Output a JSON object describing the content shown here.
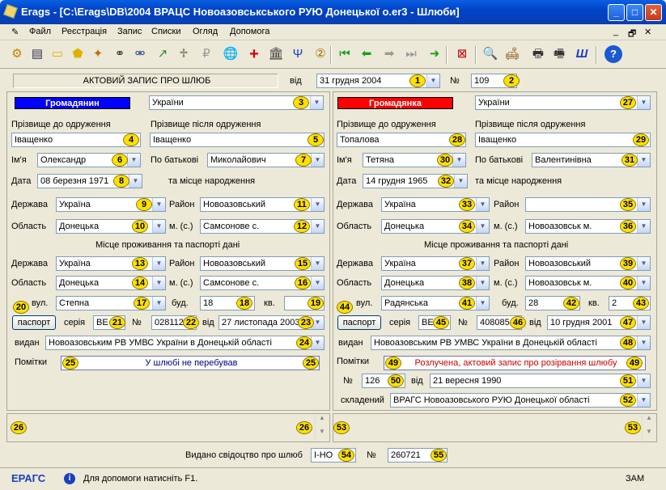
{
  "window": {
    "title": "Erags - [C:\\Erags\\DB\\2004 ВРАЦС Новоазовськського РУЮ Донецької о.er3 - Шлюби]",
    "min": "_",
    "max": "□",
    "close": "✕"
  },
  "menu": [
    "Файл",
    "Реєстрація",
    "Запис",
    "Списки",
    "Огляд",
    "Допомога"
  ],
  "menu_right": [
    "_",
    "🗗",
    "✕"
  ],
  "header": {
    "record_title": "АКТОВИЙ ЗАПИС ПРО ШЛЮБ",
    "from_label": "від",
    "date": "31 грудня 2004",
    "num_label": "№",
    "number": "109"
  },
  "husband": {
    "header": "Громадянин",
    "citizenship": "України",
    "surname_before_label": "Прізвище до одруження",
    "surname_after_label": "Прізвище після одруження",
    "surname_before": "Іващенко",
    "surname_after": "Іващенко",
    "name_label": "Ім'я",
    "name": "Олександр",
    "patronymic_label": "По батькові",
    "patronymic": "Миколайович",
    "date_label": "Дата",
    "birth_date": "08 березня 1971",
    "birth_place_label": "та місце народження",
    "state_label": "Держава",
    "birth_state": "Україна",
    "district_label": "Район",
    "birth_district": "Новоазовський",
    "region_label": "Область",
    "birth_region": "Донецька",
    "city_label": "м. (с.)",
    "birth_city": "Самсонове с.",
    "residence_title": "Місце проживання та паспорті дані",
    "res_state": "Україна",
    "res_district": "Новоазовський",
    "res_region": "Донецька",
    "res_city": "Самсонове с.",
    "street_label": "вул.",
    "street": "Степна",
    "house_label": "буд.",
    "house": "18",
    "apt_label": "кв.",
    "apt": "",
    "passport_btn": "паспорт",
    "series_label": "серія",
    "series": "ВЕ",
    "no_label": "№",
    "passport_no": "028112",
    "passport_from_label": "від",
    "passport_date": "27 листопада 2003",
    "issued_label": "видан",
    "issued_by": "Новоазовським РВ УМВС України в Донецькій області",
    "notes_label": "Помітки",
    "notes": "У шлюбі не перебував"
  },
  "wife": {
    "header": "Громадянка",
    "citizenship": "України",
    "surname_before_label": "Прізвище до одруження",
    "surname_after_label": "Прізвище після одруження",
    "surname_before": "Топалова",
    "surname_after": "Іващенко",
    "name_label": "Ім'я",
    "name": "Тетяна",
    "patronymic_label": "По батькові",
    "patronymic": "Валентинівна",
    "date_label": "Дата",
    "birth_date": "14 грудня 1965",
    "birth_place_label": "та місце народження",
    "state_label": "Держава",
    "birth_state": "Україна",
    "district_label": "Район",
    "birth_district": "",
    "region_label": "Область",
    "birth_region": "Донецька",
    "city_label": "м. (с.)",
    "birth_city": "Новоазовськ м.",
    "residence_title": "Місце проживання та паспорті дані",
    "res_state": "Україна",
    "res_district": "Новоазовський",
    "res_region": "Донецька",
    "res_city": "Новоазовськ м.",
    "street_label": "вул.",
    "street": "Радянська",
    "house_label": "буд.",
    "house": "28",
    "apt_label": "кв.",
    "apt": "2",
    "passport_btn": "паспорт",
    "series_label": "серія",
    "series": "ВЕ",
    "no_label": "№",
    "passport_no": "408085",
    "passport_from_label": "від",
    "passport_date": "10 грудня 2001",
    "issued_label": "видан",
    "issued_by": "Новоазовським РВ УМВС України в Донецькій області",
    "notes_label": "Помітки",
    "notes": "Розлучена, актовий запис про розірвання шлюбу",
    "divorce_no_label": "№",
    "divorce_no": "126",
    "divorce_from_label": "від",
    "divorce_date": "21 вересня 1990",
    "composed_label": "складений",
    "composed_by": "ВРАГС Новоазовського РУЮ Донецької області"
  },
  "footer": {
    "certificate_label": "Видано свідоцтво про шлюб",
    "cert_series": "І-НО",
    "no_label": "№",
    "cert_no": "260721"
  },
  "status": {
    "app": "ЕРАГС",
    "hint": "Для допомоги натисніть F1.",
    "mode": "ЗАМ"
  },
  "badges": {
    "b1": "1",
    "b2": "2",
    "b3": "3",
    "b4": "4",
    "b5": "5",
    "b6": "6",
    "b7": "7",
    "b8": "8",
    "b9": "9",
    "b10": "10",
    "b11": "11",
    "b12": "12",
    "b13": "13",
    "b14": "14",
    "b15": "15",
    "b16": "16",
    "b17": "17",
    "b18": "18",
    "b19": "19",
    "b20": "20",
    "b21": "21",
    "b22": "22",
    "b23": "23",
    "b24": "24",
    "b25": "25",
    "b26": "26",
    "b27": "27",
    "b28": "28",
    "b29": "29",
    "b30": "30",
    "b31": "31",
    "b32": "32",
    "b33": "33",
    "b34": "34",
    "b35": "35",
    "b36": "36",
    "b37": "37",
    "b38": "38",
    "b39": "39",
    "b40": "40",
    "b41": "41",
    "b42": "42",
    "b43": "43",
    "b44": "44",
    "b45": "45",
    "b46": "46",
    "b47": "47",
    "b48": "48",
    "b49": "49",
    "b50": "50",
    "b51": "51",
    "b52": "52",
    "b53": "53",
    "b54": "54",
    "b55": "55"
  },
  "colors": {
    "husband_header": "#0000ff",
    "wife_header": "#ff0000",
    "notes_husband": "#000080",
    "notes_wife": "#cc0000",
    "badge": "#ffe100"
  }
}
